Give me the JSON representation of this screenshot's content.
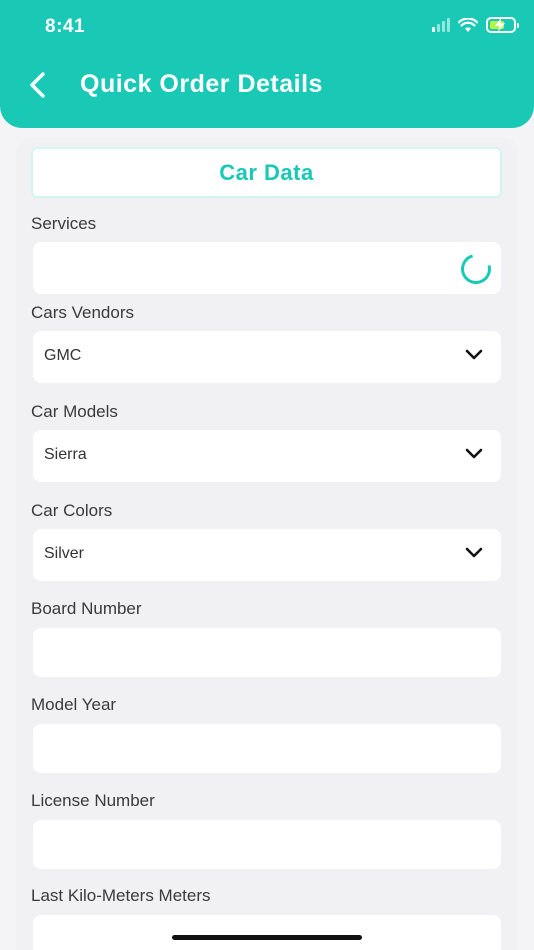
{
  "status_bar": {
    "time": "8:41"
  },
  "header": {
    "title": "Quick Order Details"
  },
  "section": {
    "title": "Car Data"
  },
  "fields": {
    "services": {
      "label": "Services",
      "value": ""
    },
    "cars_vendors": {
      "label": "Cars Vendors",
      "value": "GMC"
    },
    "car_models": {
      "label": "Car Models",
      "value": "Sierra"
    },
    "car_colors": {
      "label": "Car Colors",
      "value": "Silver"
    },
    "board_number": {
      "label": "Board Number",
      "value": ""
    },
    "model_year": {
      "label": "Model Year",
      "value": ""
    },
    "license_number": {
      "label": "License Number",
      "value": ""
    },
    "last_km": {
      "label": "Last Kilo-Meters Meters",
      "value": ""
    }
  },
  "colors": {
    "accent": "#19c9b6",
    "background": "#f4f4f6"
  }
}
